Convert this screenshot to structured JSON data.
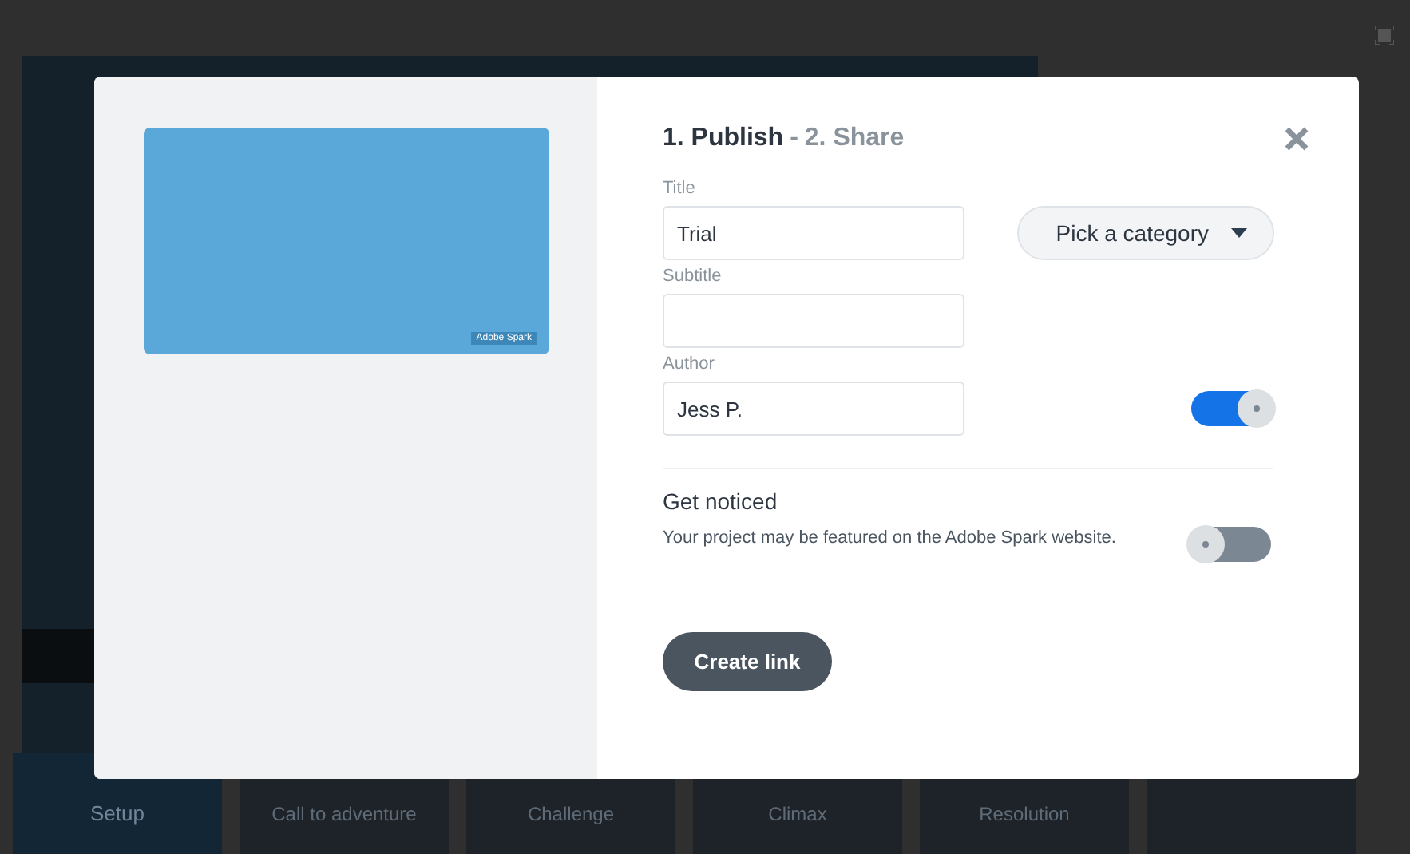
{
  "stage_tabs": [
    {
      "label": "Setup",
      "selected": true
    },
    {
      "label": "Call to adventure",
      "selected": false
    },
    {
      "label": "Challenge",
      "selected": false
    },
    {
      "label": "Climax",
      "selected": false
    },
    {
      "label": "Resolution",
      "selected": false
    },
    {
      "selected": false
    }
  ],
  "modal": {
    "steps": [
      {
        "label": "1. Publish",
        "selected": true
      },
      {
        "label": "2. Share",
        "selected": false
      }
    ],
    "step_separator": "-",
    "preview": {
      "badge": "Adobe Spark"
    },
    "fields": [
      {
        "label": "Title",
        "value": "Trial"
      },
      {
        "label": "Subtitle"
      },
      {
        "label": "Author",
        "value": "Jess P."
      }
    ],
    "category": {
      "label": "Pick a category"
    },
    "author_toggle": {
      "on": true
    },
    "get_noticed": {
      "heading": "Get noticed",
      "description": "Your project may be featured on the Adobe Spark website.",
      "on": false
    },
    "button": "Create link"
  }
}
